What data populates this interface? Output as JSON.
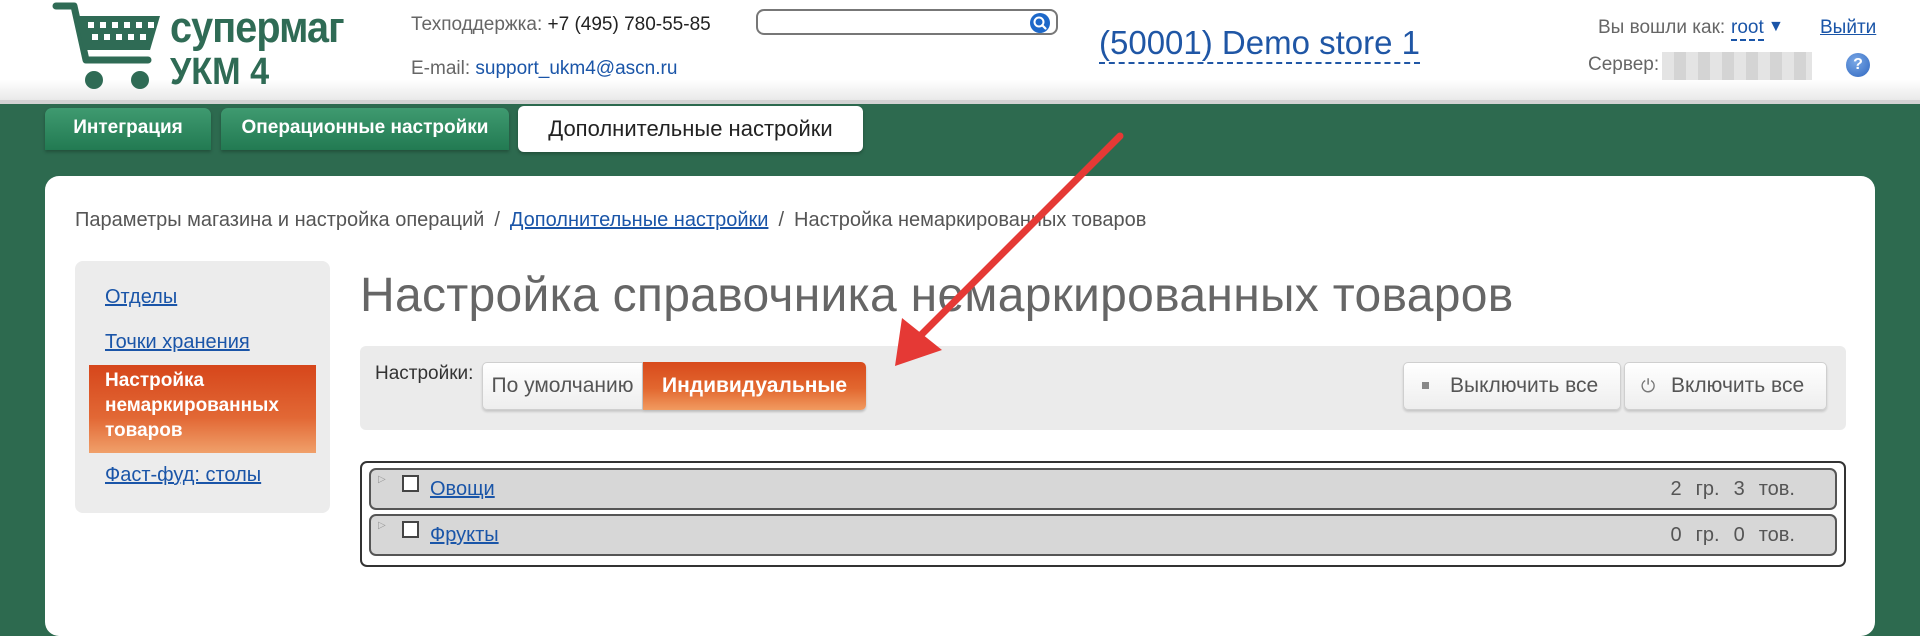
{
  "header": {
    "logo": {
      "brand": "супермаг",
      "product": "УКМ 4"
    },
    "support_label": "Техподдержка:",
    "support_phone": "+7 (495) 780-55-85",
    "email_label": "E-mail:",
    "email": "support_ukm4@ascn.ru",
    "search": {
      "value": "",
      "placeholder": ""
    },
    "store": "(50001) Demo store 1",
    "login_label": "Вы вошли как:",
    "login_user": "root",
    "login_caret": "▼",
    "logout": "Выйти",
    "server_label": "Сервер:",
    "help": "?"
  },
  "tabs": [
    {
      "label": "Интеграция",
      "active": false
    },
    {
      "label": "Операционные настройки",
      "active": false
    },
    {
      "label": "Дополнительные настройки",
      "active": true
    }
  ],
  "breadcrumb": {
    "root": "Параметры магазина и настройка операций",
    "sep": "/",
    "parent": "Дополнительные настройки",
    "current": "Настройка немаркированных товаров"
  },
  "sidebar": {
    "items": [
      {
        "label": "Отделы"
      },
      {
        "label": "Точки хранения"
      },
      {
        "label": "Настройка немаркированных товаров",
        "lines": [
          "Настройка",
          "немаркированных",
          "товаров"
        ],
        "active": true
      },
      {
        "label": "Фаст-фуд: столы"
      }
    ]
  },
  "main": {
    "title": "Настройка справочника немаркированных товаров",
    "settings_label": "Настройки:",
    "mode_default": "По умолчанию",
    "mode_individual": "Индивидуальные",
    "disable_all": "Выключить все",
    "enable_all": "Включить все",
    "tree": [
      {
        "name": "Овощи",
        "groups": "2",
        "groups_unit": "гр.",
        "items": "3",
        "items_unit": "тов."
      },
      {
        "name": "Фрукты",
        "groups": "0",
        "groups_unit": "гр.",
        "items": "0",
        "items_unit": "тов."
      }
    ]
  },
  "colors": {
    "background": "#2d6a4f",
    "accent": "#e2672f",
    "link": "#1a55a8",
    "annotation_arrow": "#e53935"
  }
}
